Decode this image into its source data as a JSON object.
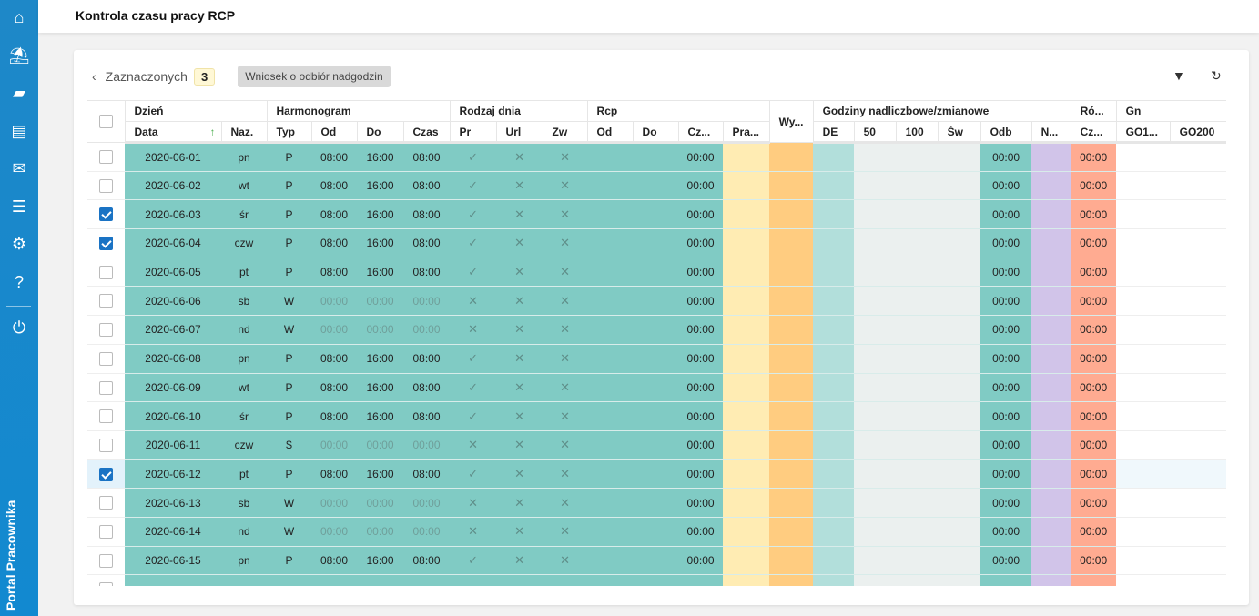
{
  "sidebar": {
    "brand": "Portal Pracownika",
    "icons": [
      "home-icon",
      "palm-tree-icon",
      "wallet-icon",
      "id-card-icon",
      "inbox-icon",
      "list-icon",
      "gear-icon",
      "help-icon",
      "power-icon"
    ]
  },
  "header": {
    "title": "Kontrola czasu pracy RCP"
  },
  "toolbar": {
    "selected_label": "Zaznaczonych",
    "selected_count": "3",
    "overtime_button": "Wniosek o odbiór nadgodzin"
  },
  "table": {
    "groups": {
      "day": "Dzień",
      "schedule": "Harmonogram",
      "day_type": "Rodzaj dnia",
      "rcp": "Rcp",
      "wy": "Wy...",
      "overtime": "Godziny nadliczbowe/zmianowe",
      "ro": "Ró...",
      "gn": "Gn"
    },
    "columns": {
      "date": "Data",
      "name": "Naz.",
      "type": "Typ",
      "from": "Od",
      "to": "Do",
      "time": "Czas",
      "pr": "Pr",
      "url": "Url",
      "zw": "Zw",
      "rcp_from": "Od",
      "rcp_to": "Do",
      "rcp_time": "Cz...",
      "pra": "Pra...",
      "de": "DE",
      "p50": "50",
      "p100": "100",
      "sw": "Św",
      "odb": "Odb",
      "n": "N...",
      "ro_cz": "Cz...",
      "go1": "GO1...",
      "go200": "GO200"
    },
    "sort": {
      "column": "Data",
      "direction": "ascending"
    },
    "rows": [
      {
        "checked": false,
        "date": "2020-06-01",
        "name": "pn",
        "type": "P",
        "from": "08:00",
        "to": "16:00",
        "time": "08:00",
        "pr": "check",
        "url": "x",
        "zw": "x",
        "rcp_time": "00:00",
        "odb": "00:00",
        "ro_cz": "00:00"
      },
      {
        "checked": false,
        "date": "2020-06-02",
        "name": "wt",
        "type": "P",
        "from": "08:00",
        "to": "16:00",
        "time": "08:00",
        "pr": "check",
        "url": "x",
        "zw": "x",
        "rcp_time": "00:00",
        "odb": "00:00",
        "ro_cz": "00:00"
      },
      {
        "checked": true,
        "date": "2020-06-03",
        "name": "śr",
        "type": "P",
        "from": "08:00",
        "to": "16:00",
        "time": "08:00",
        "pr": "check",
        "url": "x",
        "zw": "x",
        "rcp_time": "00:00",
        "odb": "00:00",
        "ro_cz": "00:00"
      },
      {
        "checked": true,
        "date": "2020-06-04",
        "name": "czw",
        "type": "P",
        "from": "08:00",
        "to": "16:00",
        "time": "08:00",
        "pr": "check",
        "url": "x",
        "zw": "x",
        "rcp_time": "00:00",
        "odb": "00:00",
        "ro_cz": "00:00"
      },
      {
        "checked": false,
        "date": "2020-06-05",
        "name": "pt",
        "type": "P",
        "from": "08:00",
        "to": "16:00",
        "time": "08:00",
        "pr": "check",
        "url": "x",
        "zw": "x",
        "rcp_time": "00:00",
        "odb": "00:00",
        "ro_cz": "00:00"
      },
      {
        "checked": false,
        "date": "2020-06-06",
        "name": "sb",
        "type": "W",
        "from": "00:00",
        "to": "00:00",
        "time": "00:00",
        "pr": "x",
        "url": "x",
        "zw": "x",
        "rcp_time": "00:00",
        "odb": "00:00",
        "ro_cz": "00:00",
        "off": true
      },
      {
        "checked": false,
        "date": "2020-06-07",
        "name": "nd",
        "type": "W",
        "from": "00:00",
        "to": "00:00",
        "time": "00:00",
        "pr": "x",
        "url": "x",
        "zw": "x",
        "rcp_time": "00:00",
        "odb": "00:00",
        "ro_cz": "00:00",
        "off": true
      },
      {
        "checked": false,
        "date": "2020-06-08",
        "name": "pn",
        "type": "P",
        "from": "08:00",
        "to": "16:00",
        "time": "08:00",
        "pr": "check",
        "url": "x",
        "zw": "x",
        "rcp_time": "00:00",
        "odb": "00:00",
        "ro_cz": "00:00"
      },
      {
        "checked": false,
        "date": "2020-06-09",
        "name": "wt",
        "type": "P",
        "from": "08:00",
        "to": "16:00",
        "time": "08:00",
        "pr": "check",
        "url": "x",
        "zw": "x",
        "rcp_time": "00:00",
        "odb": "00:00",
        "ro_cz": "00:00"
      },
      {
        "checked": false,
        "date": "2020-06-10",
        "name": "śr",
        "type": "P",
        "from": "08:00",
        "to": "16:00",
        "time": "08:00",
        "pr": "check",
        "url": "x",
        "zw": "x",
        "rcp_time": "00:00",
        "odb": "00:00",
        "ro_cz": "00:00"
      },
      {
        "checked": false,
        "date": "2020-06-11",
        "name": "czw",
        "type": "$",
        "from": "00:00",
        "to": "00:00",
        "time": "00:00",
        "pr": "x",
        "url": "x",
        "zw": "x",
        "rcp_time": "00:00",
        "odb": "00:00",
        "ro_cz": "00:00",
        "off": true
      },
      {
        "checked": true,
        "date": "2020-06-12",
        "name": "pt",
        "type": "P",
        "from": "08:00",
        "to": "16:00",
        "time": "08:00",
        "pr": "check",
        "url": "x",
        "zw": "x",
        "rcp_time": "00:00",
        "odb": "00:00",
        "ro_cz": "00:00",
        "highlighted": true
      },
      {
        "checked": false,
        "date": "2020-06-13",
        "name": "sb",
        "type": "W",
        "from": "00:00",
        "to": "00:00",
        "time": "00:00",
        "pr": "x",
        "url": "x",
        "zw": "x",
        "rcp_time": "00:00",
        "odb": "00:00",
        "ro_cz": "00:00",
        "off": true
      },
      {
        "checked": false,
        "date": "2020-06-14",
        "name": "nd",
        "type": "W",
        "from": "00:00",
        "to": "00:00",
        "time": "00:00",
        "pr": "x",
        "url": "x",
        "zw": "x",
        "rcp_time": "00:00",
        "odb": "00:00",
        "ro_cz": "00:00",
        "off": true
      },
      {
        "checked": false,
        "date": "2020-06-15",
        "name": "pn",
        "type": "P",
        "from": "08:00",
        "to": "16:00",
        "time": "08:00",
        "pr": "check",
        "url": "x",
        "zw": "x",
        "rcp_time": "00:00",
        "odb": "00:00",
        "ro_cz": "00:00"
      }
    ]
  },
  "colors": {
    "sidebar": "#1e88c8",
    "schedule": "#80cbc4",
    "pra": "#ffecb3",
    "wy": "#ffcc80",
    "de": "#b2dfdb",
    "overtime": "#ebf0ef",
    "n": "#d1c4e9",
    "ro": "#ffab91",
    "checkbox": "#1a73c4"
  }
}
